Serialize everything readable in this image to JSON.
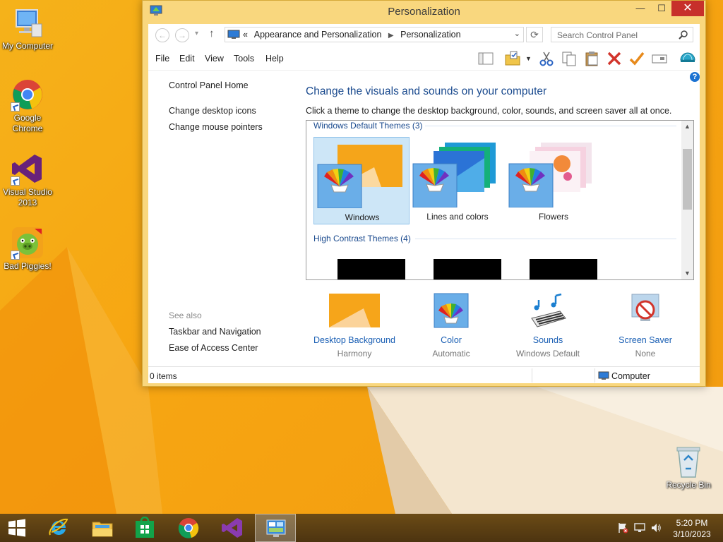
{
  "desktop": {
    "icons": [
      {
        "label": "My Computer"
      },
      {
        "label": "Google Chrome"
      },
      {
        "label": "Visual Studio 2013"
      },
      {
        "label": "Bad Piggies!"
      },
      {
        "label": "Recycle Bin"
      }
    ]
  },
  "window": {
    "title": "Personalization",
    "controls": {
      "minimize": "—",
      "maximize": "☐",
      "close": "✕"
    },
    "nav": {
      "back": "←",
      "forward": "→",
      "recent": "▾",
      "up": "↑",
      "refresh": "⟳"
    },
    "breadcrumb": {
      "prefix": "«",
      "items": [
        "Appearance and Personalization",
        "Personalization"
      ],
      "separator": "▶"
    },
    "search": {
      "placeholder": "Search Control Panel"
    },
    "menu": [
      "File",
      "Edit",
      "View",
      "Tools",
      "Help"
    ],
    "toolbar_icons": [
      "layout-icon",
      "properties-folder-icon",
      "cut-icon",
      "copy-icon",
      "paste-icon",
      "delete-icon",
      "check-icon",
      "rename-icon",
      "globe-icon"
    ],
    "help_glyph": "?"
  },
  "sidebar": {
    "home": "Control Panel Home",
    "links": [
      "Change desktop icons",
      "Change mouse pointers"
    ],
    "see_also": "See also",
    "see_also_links": [
      "Taskbar and Navigation",
      "Ease of Access Center"
    ]
  },
  "main": {
    "heading": "Change the visuals and sounds on your computer",
    "subheading": "Click a theme to change the desktop background, color, sounds, and screen saver all at once.",
    "groups": [
      {
        "title": "Windows Default Themes (3)",
        "themes": [
          "Windows",
          "Lines and colors",
          "Flowers"
        ],
        "selected": "Windows"
      },
      {
        "title": "High Contrast Themes (4)"
      }
    ],
    "scroll": {
      "up": "▲",
      "down": "▼"
    },
    "settings": [
      {
        "label": "Desktop Background",
        "value": "Harmony"
      },
      {
        "label": "Color",
        "value": "Automatic"
      },
      {
        "label": "Sounds",
        "value": "Windows Default"
      },
      {
        "label": "Screen Saver",
        "value": "None"
      }
    ]
  },
  "status": {
    "items": "0 items",
    "location": "Computer"
  },
  "taskbar": {
    "items": [
      "start-icon",
      "internet-explorer-icon",
      "file-explorer-icon",
      "store-icon",
      "chrome-icon",
      "visual-studio-icon",
      "control-panel-icon"
    ],
    "clock": {
      "time": "5:20 PM",
      "date": "3/10/2023"
    }
  },
  "colors": {
    "accent_text": "#1a4a8e",
    "link": "#1a5fb4",
    "selected_tile": "#cde6f7",
    "close_button": "#c7302b",
    "window_frame": "#f9d77e"
  }
}
